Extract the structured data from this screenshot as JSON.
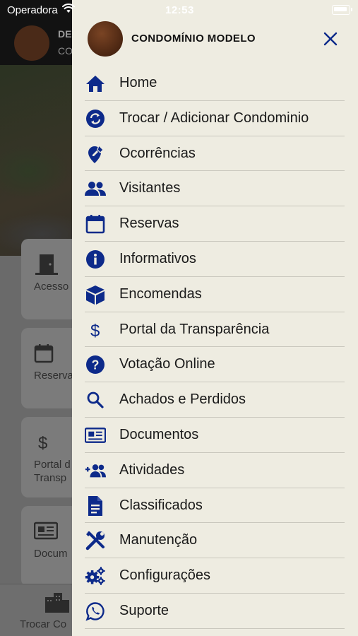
{
  "status_bar": {
    "carrier": "Operadora",
    "time": "12:53"
  },
  "background_app": {
    "header": {
      "name_partial": "DE",
      "sub_partial": "CO"
    },
    "cards": [
      {
        "label": "Acesso",
        "icon": "door-icon"
      },
      {
        "label": "Reserva",
        "icon": "calendar-icon"
      },
      {
        "label": "Portal d\nTransp",
        "icon": "dollar-icon"
      },
      {
        "label": "Docum",
        "icon": "document-icon"
      }
    ],
    "bottom_tab": {
      "label": "Trocar Co",
      "icon": "buildings-icon"
    }
  },
  "drawer": {
    "title": "CONDOMÍNIO MODELO",
    "accent_color": "#0d2a8a",
    "items": [
      {
        "label": "Home",
        "icon": "home-icon"
      },
      {
        "label": "Trocar / Adicionar Condominio",
        "icon": "swap-icon"
      },
      {
        "label": "Ocorrências",
        "icon": "location-edit-icon"
      },
      {
        "label": "Visitantes",
        "icon": "people-icon"
      },
      {
        "label": "Reservas",
        "icon": "calendar-icon"
      },
      {
        "label": "Informativos",
        "icon": "info-icon"
      },
      {
        "label": "Encomendas",
        "icon": "package-icon"
      },
      {
        "label": "Portal da Transparência",
        "icon": "dollar-icon"
      },
      {
        "label": "Votação Online",
        "icon": "help-icon"
      },
      {
        "label": "Achados e Perdidos",
        "icon": "search-icon"
      },
      {
        "label": "Documentos",
        "icon": "newspaper-icon"
      },
      {
        "label": "Atividades",
        "icon": "group-add-icon"
      },
      {
        "label": "Classificados",
        "icon": "document-text-icon"
      },
      {
        "label": "Manutenção",
        "icon": "tools-icon"
      },
      {
        "label": "Configurações",
        "icon": "gears-icon"
      },
      {
        "label": "Suporte",
        "icon": "whatsapp-icon"
      }
    ]
  }
}
